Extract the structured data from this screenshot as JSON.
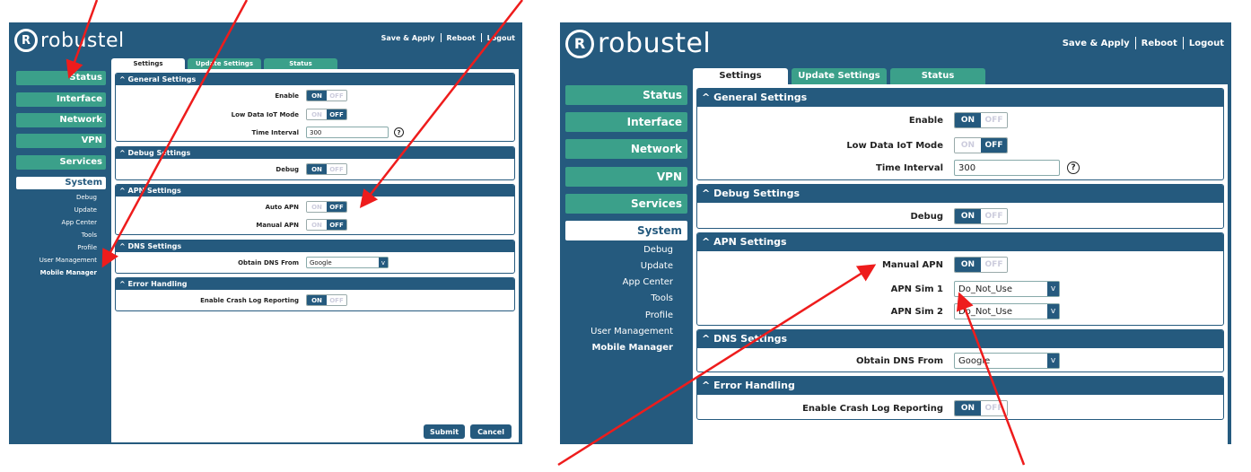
{
  "brand": {
    "name": "robustel",
    "mark": "R"
  },
  "header": {
    "save_apply": "Save & Apply",
    "reboot": "Reboot",
    "logout": "Logout"
  },
  "colors": {
    "navy": "#255a7e",
    "green": "#3ba08a",
    "arrow": "#ee1c1c"
  },
  "left": {
    "tabs": [
      "Settings",
      "Update Settings",
      "Status"
    ],
    "sidebar": [
      "Status",
      "Interface",
      "Network",
      "VPN",
      "Services",
      "System"
    ],
    "sub": [
      "Debug",
      "Update",
      "App Center",
      "Tools",
      "Profile",
      "User Management",
      "Mobile Manager"
    ],
    "sections": {
      "general": {
        "title": "General Settings",
        "enable": {
          "label": "Enable",
          "state": "ON"
        },
        "lowdata": {
          "label": "Low Data IoT Mode",
          "state": "OFF"
        },
        "interval": {
          "label": "Time Interval",
          "value": "300"
        }
      },
      "debug": {
        "title": "Debug Settings",
        "debug": {
          "label": "Debug",
          "state": "ON"
        }
      },
      "apn": {
        "title": "APN Settings",
        "auto": {
          "label": "Auto APN",
          "state": "OFF"
        },
        "manual": {
          "label": "Manual APN",
          "state": "OFF"
        }
      },
      "dns": {
        "title": "DNS Settings",
        "obtain": {
          "label": "Obtain DNS From",
          "value": "Google"
        }
      },
      "error": {
        "title": "Error Handling",
        "crash": {
          "label": "Enable Crash Log Reporting",
          "state": "ON"
        }
      }
    },
    "buttons": {
      "submit": "Submit",
      "cancel": "Cancel"
    }
  },
  "right": {
    "tabs": [
      "Settings",
      "Update Settings",
      "Status"
    ],
    "sidebar": [
      "Status",
      "Interface",
      "Network",
      "VPN",
      "Services",
      "System"
    ],
    "sub": [
      "Debug",
      "Update",
      "App Center",
      "Tools",
      "Profile",
      "User Management",
      "Mobile Manager"
    ],
    "sections": {
      "general": {
        "title": "General Settings",
        "enable": {
          "label": "Enable",
          "state": "ON"
        },
        "lowdata": {
          "label": "Low Data IoT Mode",
          "state": "OFF"
        },
        "interval": {
          "label": "Time Interval",
          "value": "300"
        }
      },
      "debug": {
        "title": "Debug Settings",
        "debug": {
          "label": "Debug",
          "state": "ON"
        }
      },
      "apn": {
        "title": "APN Settings",
        "manual": {
          "label": "Manual APN",
          "state": "ON"
        },
        "sim1": {
          "label": "APN Sim 1",
          "value": "Do_Not_Use"
        },
        "sim2": {
          "label": "APN Sim 2",
          "value": "Do_Not_Use"
        }
      },
      "dns": {
        "title": "DNS Settings",
        "obtain": {
          "label": "Obtain DNS From",
          "value": "Google"
        }
      },
      "error": {
        "title": "Error Handling",
        "crash": {
          "label": "Enable Crash Log Reporting",
          "state": "ON"
        }
      }
    }
  },
  "glyphs": {
    "caret": "^",
    "dropdown": "v",
    "help": "?",
    "on": "ON",
    "off": "OFF"
  }
}
